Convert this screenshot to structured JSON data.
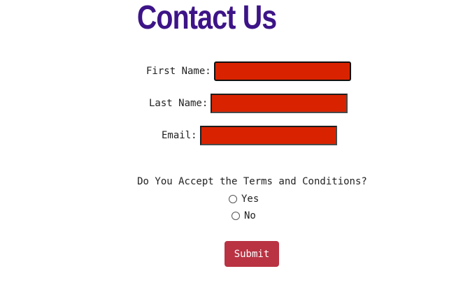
{
  "page": {
    "title": "Contact Us"
  },
  "form": {
    "first_name": {
      "label": "First Name:",
      "value": ""
    },
    "last_name": {
      "label": "Last Name:",
      "value": ""
    },
    "email": {
      "label": "Email:",
      "value": ""
    },
    "terms_question": "Do You Accept the Terms and Conditions?",
    "options": [
      {
        "label": "Yes",
        "selected": false
      },
      {
        "label": "No",
        "selected": false
      }
    ],
    "submit_label": "Submit"
  },
  "colors": {
    "title": "#3d1487",
    "field_background": "#d92300",
    "submit_background": "#b93343"
  }
}
